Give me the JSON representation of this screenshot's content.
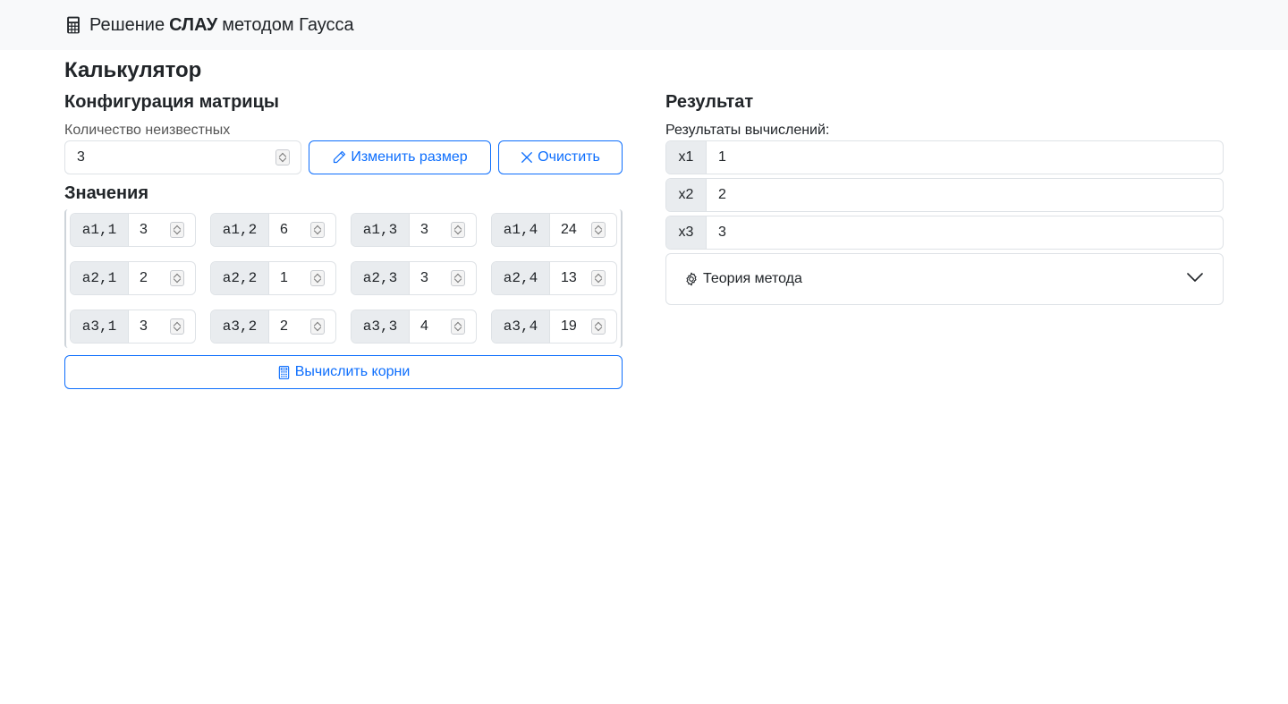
{
  "navbar": {
    "title_prefix": "Решение",
    "title_bold": "СЛАУ",
    "title_suffix": "методом Гаусса"
  },
  "calculator": {
    "heading": "Калькулятор",
    "config": {
      "heading": "Конфигурация матрицы",
      "unknowns_label": "Количество неизвестных",
      "unknowns_value": "3",
      "resize_label": "Изменить размер",
      "clear_label": "Очистить"
    },
    "values_heading": "Значения",
    "matrix": [
      [
        {
          "label": "a1,1",
          "value": "3"
        },
        {
          "label": "a1,2",
          "value": "6"
        },
        {
          "label": "a1,3",
          "value": "3"
        },
        {
          "label": "a1,4",
          "value": "24"
        }
      ],
      [
        {
          "label": "a2,1",
          "value": "2"
        },
        {
          "label": "a2,2",
          "value": "1"
        },
        {
          "label": "a2,3",
          "value": "3"
        },
        {
          "label": "a2,4",
          "value": "13"
        }
      ],
      [
        {
          "label": "a3,1",
          "value": "3"
        },
        {
          "label": "a3,2",
          "value": "2"
        },
        {
          "label": "a3,3",
          "value": "4"
        },
        {
          "label": "a3,4",
          "value": "19"
        }
      ]
    ],
    "compute_label": "Вычислить корни"
  },
  "result": {
    "heading": "Результат",
    "subheading": "Результаты вычислений:",
    "rows": [
      {
        "label": "x1",
        "value": "1"
      },
      {
        "label": "x2",
        "value": "2"
      },
      {
        "label": "x3",
        "value": "3"
      }
    ],
    "theory_label": "Теория метода"
  },
  "colors": {
    "accent": "#0d6efd",
    "navbar_bg": "#f8f9fa",
    "addon_bg": "#e9ecef",
    "border": "#dee2e6"
  }
}
